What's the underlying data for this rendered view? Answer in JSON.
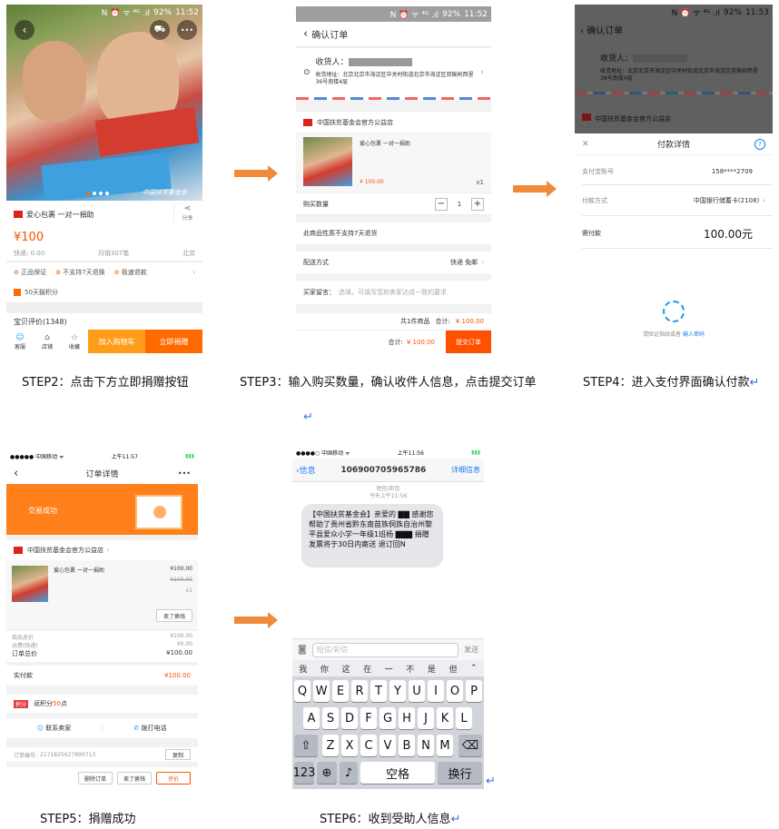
{
  "captions": {
    "step2": "STEP2：点击下方立即捐赠按钮",
    "step3": "STEP3：输入购买数量，确认收件人信息，点击提交订单",
    "step4": "STEP4：进入支付界面确认付款",
    "step5": "STEP5：捐赠成功",
    "step6": "STEP6：收到受助人信息",
    "return_mark": "↵"
  },
  "colors": {
    "accent": "#ff6a00",
    "orange_btn": "#ff9c1a",
    "arrow": "#ee8a3a",
    "ios_blue": "#1a7cf0"
  },
  "screen1": {
    "status": {
      "icons": "N ⏰ ᯤ ⁴ᴳ .ıl",
      "battery": "92%",
      "time": "11:52"
    },
    "back_icon": "back-icon",
    "cart_icon": "cart-icon",
    "more": "•••",
    "watermark": "中国扶贫基金会",
    "product_title": "爱心包裹 一对一捐助",
    "share": "分享",
    "price": "¥100",
    "shipping": "快递: 0.00",
    "monthly_sales": "月销307笔",
    "location": "北京",
    "guarantees": [
      "正品保证",
      "不支持7天退换",
      "极速退款"
    ],
    "points": "50天猫积分",
    "reviews": "宝贝评价(1348)",
    "nav": [
      "客服",
      "店铺",
      "收藏"
    ],
    "add_to_cart": "加入购物车",
    "donate_now": "立即捐赠"
  },
  "screen2": {
    "status": {
      "icons": "N ⏰ ᯤ ⁴ᴳ .ıl",
      "battery": "92%",
      "time": "11:52"
    },
    "title": "确认订单",
    "receiver_label": "收货人：",
    "address": "收货地址：北京北京市海淀区中关村街道北京市海淀区双榆树西里36号南楼4层",
    "shop": "中国扶贫基金会官方公益店",
    "item_name": "爱心包裹 一对一捐助",
    "item_price": "¥ 100.00",
    "item_qty": "x1",
    "qty_label": "购买数量",
    "qty_value": "1",
    "minus": "−",
    "plus": "+",
    "no_return": "此商品性质不支持7天退货",
    "delivery_label": "配送方式",
    "delivery_value": "快递 免邮",
    "message_label": "买家留言：",
    "message_placeholder": "选填，可填写您和卖家达成一致的要求",
    "summary_count": "共1件商品",
    "summary_total_label": "合计:",
    "summary_total": "¥ 100.00",
    "footer_total_label": "合计:",
    "footer_total": "¥ 100.00",
    "submit": "提交订单"
  },
  "screen3": {
    "status": {
      "icons": "N ⏰ ᯤ ⁴ᴳ .ıl",
      "battery": "92%",
      "time": "11:53"
    },
    "bg_title": "确认订单",
    "bg_receiver": "收货人：",
    "bg_address": "收货地址：北京北京市海淀区中关村街道北京市海淀区双榆树西里36号南楼4层",
    "bg_shop": "中国扶贫基金会官方公益店",
    "sheet_title": "付款详情",
    "close": "✕",
    "help": "?",
    "account_label": "支付宝账号",
    "account_value": "158****2709",
    "method_label": "付款方式",
    "method_value": "中国银行储蓄卡(2108)",
    "due_label": "需付款",
    "due_value": "100.00元",
    "fp_prompt": "请验证指纹或者",
    "fp_link": "输入密码"
  },
  "screen4": {
    "status": {
      "carrier": "●●●●● 中国移动 ᯤ",
      "time": "上午11:57",
      "battery": "▮▮▮"
    },
    "title": "订单详情",
    "more": "•••",
    "banner": "交易成功",
    "shop": "中国扶贫基金会官方公益店",
    "item_name": "爱心包裹 一对一捐助",
    "item_price": "¥100.00",
    "item_orig": "¥100.00",
    "item_qty": "x1",
    "resell": "卖了换钱",
    "goods_total_label": "商品总价",
    "goods_total": "¥100.00",
    "ship_label": "运费(快递)",
    "ship_value": "¥0.00",
    "order_total_label": "订单总价",
    "order_total": "¥100.00",
    "paid_label": "实付款",
    "paid_value": "¥100.00",
    "points_tag": "积分",
    "points_text": "返积分",
    "points_num": "50",
    "points_unit": "点",
    "contact": "联系卖家",
    "call": "拨打电话",
    "order_no_label": "订单编号:",
    "order_no": "2171825627890713",
    "copy": "复制",
    "footer": [
      "删除订单",
      "卖了换钱",
      "评价"
    ]
  },
  "screen5": {
    "status": {
      "carrier": "●●●●○ 中国移动 ᯤ",
      "time": "上午11:56",
      "battery": "▮▮▮"
    },
    "back": "信息",
    "sender": "106900705965786",
    "details": "详细信息",
    "meta1": "短信/彩信",
    "meta2": "今天上午11:56",
    "message": "【中国扶贫基金会】亲爱的 ▇▇ 感谢您帮助了贵州省黔东南苗族侗族自治州黎平县爱众小学一年级1班杨 ▇▇▇ 捐赠发票将于30日内寄送 退订回N",
    "input_placeholder": "短信/彩信",
    "send": "发送",
    "candidates": [
      "我",
      "你",
      "这",
      "在",
      "一",
      "不",
      "是",
      "但"
    ],
    "row1": [
      "Q",
      "W",
      "E",
      "R",
      "T",
      "Y",
      "U",
      "I",
      "O",
      "P"
    ],
    "row2": [
      "A",
      "S",
      "D",
      "F",
      "G",
      "H",
      "J",
      "K",
      "L"
    ],
    "row3": [
      "Z",
      "X",
      "C",
      "V",
      "B",
      "N",
      "M"
    ],
    "k123": "123",
    "space": "空格",
    "enter": "换行"
  }
}
